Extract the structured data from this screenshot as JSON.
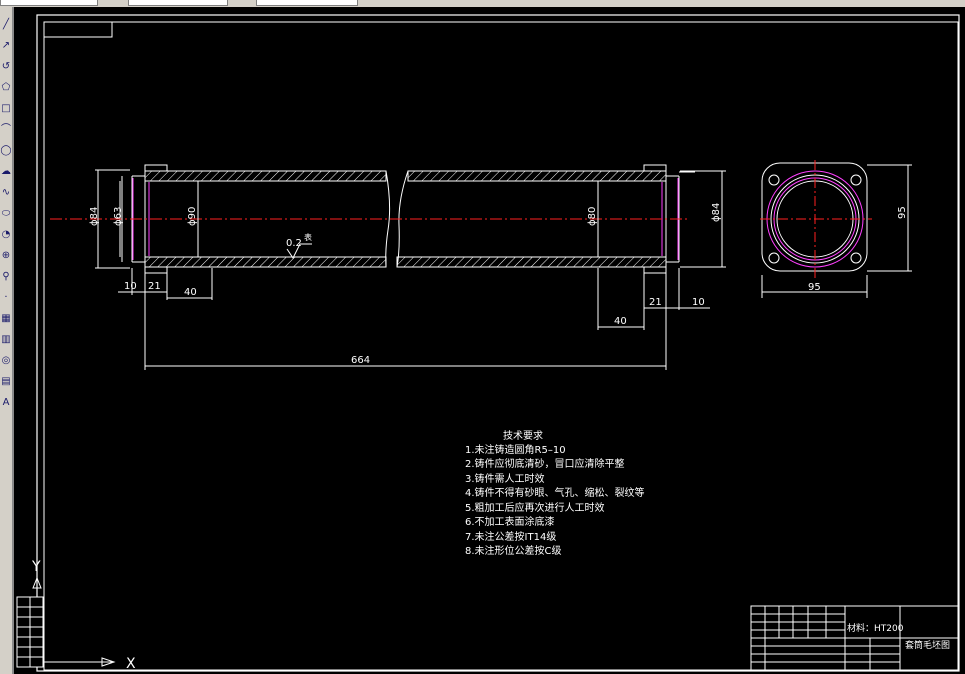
{
  "toolbar": {
    "tools": [
      {
        "name": "line-tool-icon",
        "glyph": "╱"
      },
      {
        "name": "construction-line-tool-icon",
        "glyph": "↗"
      },
      {
        "name": "polyline-tool-icon",
        "glyph": "↺"
      },
      {
        "name": "polygon-tool-icon",
        "glyph": "⬠"
      },
      {
        "name": "rectangle-tool-icon",
        "glyph": "□"
      },
      {
        "name": "arc-tool-icon",
        "glyph": "⌒"
      },
      {
        "name": "circle-tool-icon",
        "glyph": "◯"
      },
      {
        "name": "revision-cloud-tool-icon",
        "glyph": "☁"
      },
      {
        "name": "spline-tool-icon",
        "glyph": "∿"
      },
      {
        "name": "ellipse-tool-icon",
        "glyph": "⬭"
      },
      {
        "name": "ellipse-arc-tool-icon",
        "glyph": "◔"
      },
      {
        "name": "insert-block-tool-icon",
        "glyph": "⊕"
      },
      {
        "name": "make-block-tool-icon",
        "glyph": "⚲"
      },
      {
        "name": "point-tool-icon",
        "glyph": "·"
      },
      {
        "name": "hatch-tool-icon",
        "glyph": "▦"
      },
      {
        "name": "gradient-tool-icon",
        "glyph": "▥"
      },
      {
        "name": "region-tool-icon",
        "glyph": "◎"
      },
      {
        "name": "table-tool-icon",
        "glyph": "▤"
      },
      {
        "name": "multiline-text-tool-icon",
        "glyph": "A"
      }
    ]
  },
  "ucs": {
    "y": "Y",
    "x": "X"
  },
  "drawing": {
    "dimensions": {
      "d_left_outer": "ϕ84",
      "d_left_inner": "ϕ63",
      "d_mid": "ϕ90",
      "d_right_inner": "ϕ80",
      "d_right_outer": "ϕ84",
      "w10_left": "10",
      "w21_left": "21",
      "w40_left": "40",
      "w40_right": "40",
      "w21_right": "21",
      "w10_right": "10",
      "total_length": "664",
      "end_width": "95",
      "end_height": "95"
    },
    "roughness": "0.2",
    "roughness_suffix": "表",
    "tech_requirements": {
      "title": "技术要求",
      "items": [
        "1.未注铸造圆角R5–10",
        "2.铸件应彻底清砂，冒口应清除平整",
        "3.铸件需人工时效",
        "4.铸件不得有砂眼、气孔、缩松、裂纹等",
        "5.粗加工后应再次进行人工时效",
        "6.不加工表面涂底漆",
        "7.未注公差按IT14级",
        "8.未注形位公差按C级"
      ]
    },
    "title_block": {
      "material": "材料：HT200",
      "drawing_name": "套筒毛坯图"
    }
  },
  "colors": {
    "line": "#ffffff",
    "centerline": "#ff2020",
    "bore": "#ff40ff",
    "toolbar_bg": "#d4d0c8",
    "icon": "#1a1a6a"
  }
}
